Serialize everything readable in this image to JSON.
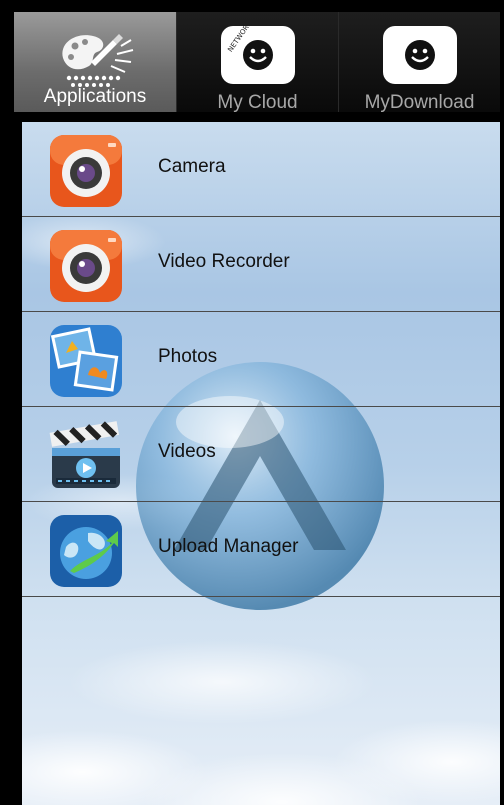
{
  "tabs": [
    {
      "label": "Applications",
      "icon": "palette-icon",
      "active": true
    },
    {
      "label": "My Cloud",
      "icon": "network-attached-smiley-icon",
      "active": false
    },
    {
      "label": "MyDownload",
      "icon": "network-attached-smiley-icon",
      "active": false
    }
  ],
  "badge_text": "NETWORK ATTACHED",
  "apps": [
    {
      "label": "Camera",
      "icon": "camera-icon"
    },
    {
      "label": "Video Recorder",
      "icon": "video-recorder-icon"
    },
    {
      "label": "Photos",
      "icon": "photos-icon"
    },
    {
      "label": "Videos",
      "icon": "videos-clapperboard-icon"
    },
    {
      "label": "Upload Manager",
      "icon": "upload-manager-icon"
    }
  ],
  "colors": {
    "camera_orange": "#e8561c",
    "active_tab": "#8a8a8a",
    "divider": "#4a4a4a",
    "sky": "#a9c6e4"
  }
}
